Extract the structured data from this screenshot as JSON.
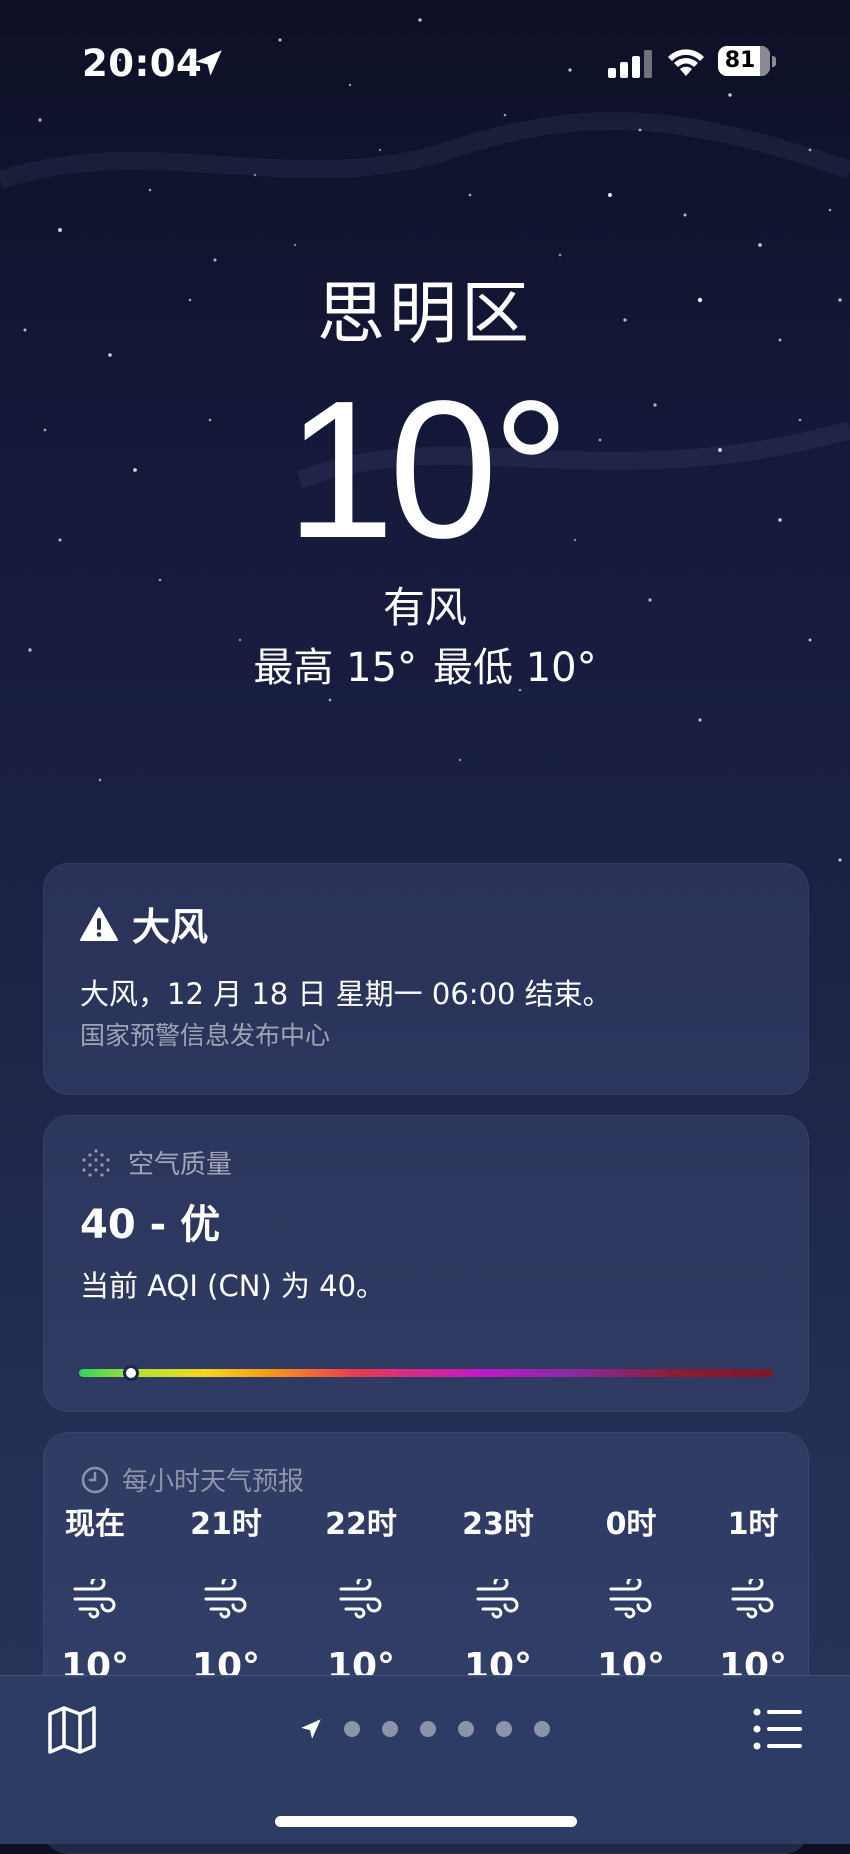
{
  "status_bar": {
    "time": "20:04",
    "battery": "81",
    "location_icon": "location-arrow-icon",
    "signal_icon": "cellular-signal-icon",
    "wifi_icon": "wifi-icon"
  },
  "current": {
    "city": "思明区",
    "temperature": "10°",
    "condition": "有风",
    "high": "最高 15°",
    "low": "最低 10°"
  },
  "alert": {
    "icon": "warning-triangle-icon",
    "title": "大风",
    "body": "大风，12 月 18 日 星期一 06:00 结束。",
    "source": "国家预警信息发布中心"
  },
  "air_quality": {
    "icon": "air-quality-dots-icon",
    "header": "空气质量",
    "value": "40 - 优",
    "description": "当前 AQI (CN) 为 40。",
    "scale_position": 0.075,
    "scale_colors": [
      "#32d35a",
      "#f3d81e",
      "#f6951c",
      "#ea3a52",
      "#c317c8",
      "#8a1e3a"
    ]
  },
  "hourly": {
    "icon": "clock-icon",
    "header": "每小时天气预报",
    "items": [
      {
        "time": "现在",
        "icon": "wind-icon",
        "temp": "10°"
      },
      {
        "time": "21时",
        "icon": "wind-icon",
        "temp": "10°"
      },
      {
        "time": "22时",
        "icon": "wind-icon",
        "temp": "10°"
      },
      {
        "time": "23时",
        "icon": "wind-icon",
        "temp": "10°"
      },
      {
        "time": "0时",
        "icon": "wind-icon",
        "temp": "10°"
      },
      {
        "time": "1时",
        "icon": "wind-icon",
        "temp": "10°"
      }
    ]
  },
  "bottom_bar": {
    "map_icon": "map-icon",
    "list_icon": "list-icon",
    "page_count": 6,
    "current_page": "location"
  }
}
